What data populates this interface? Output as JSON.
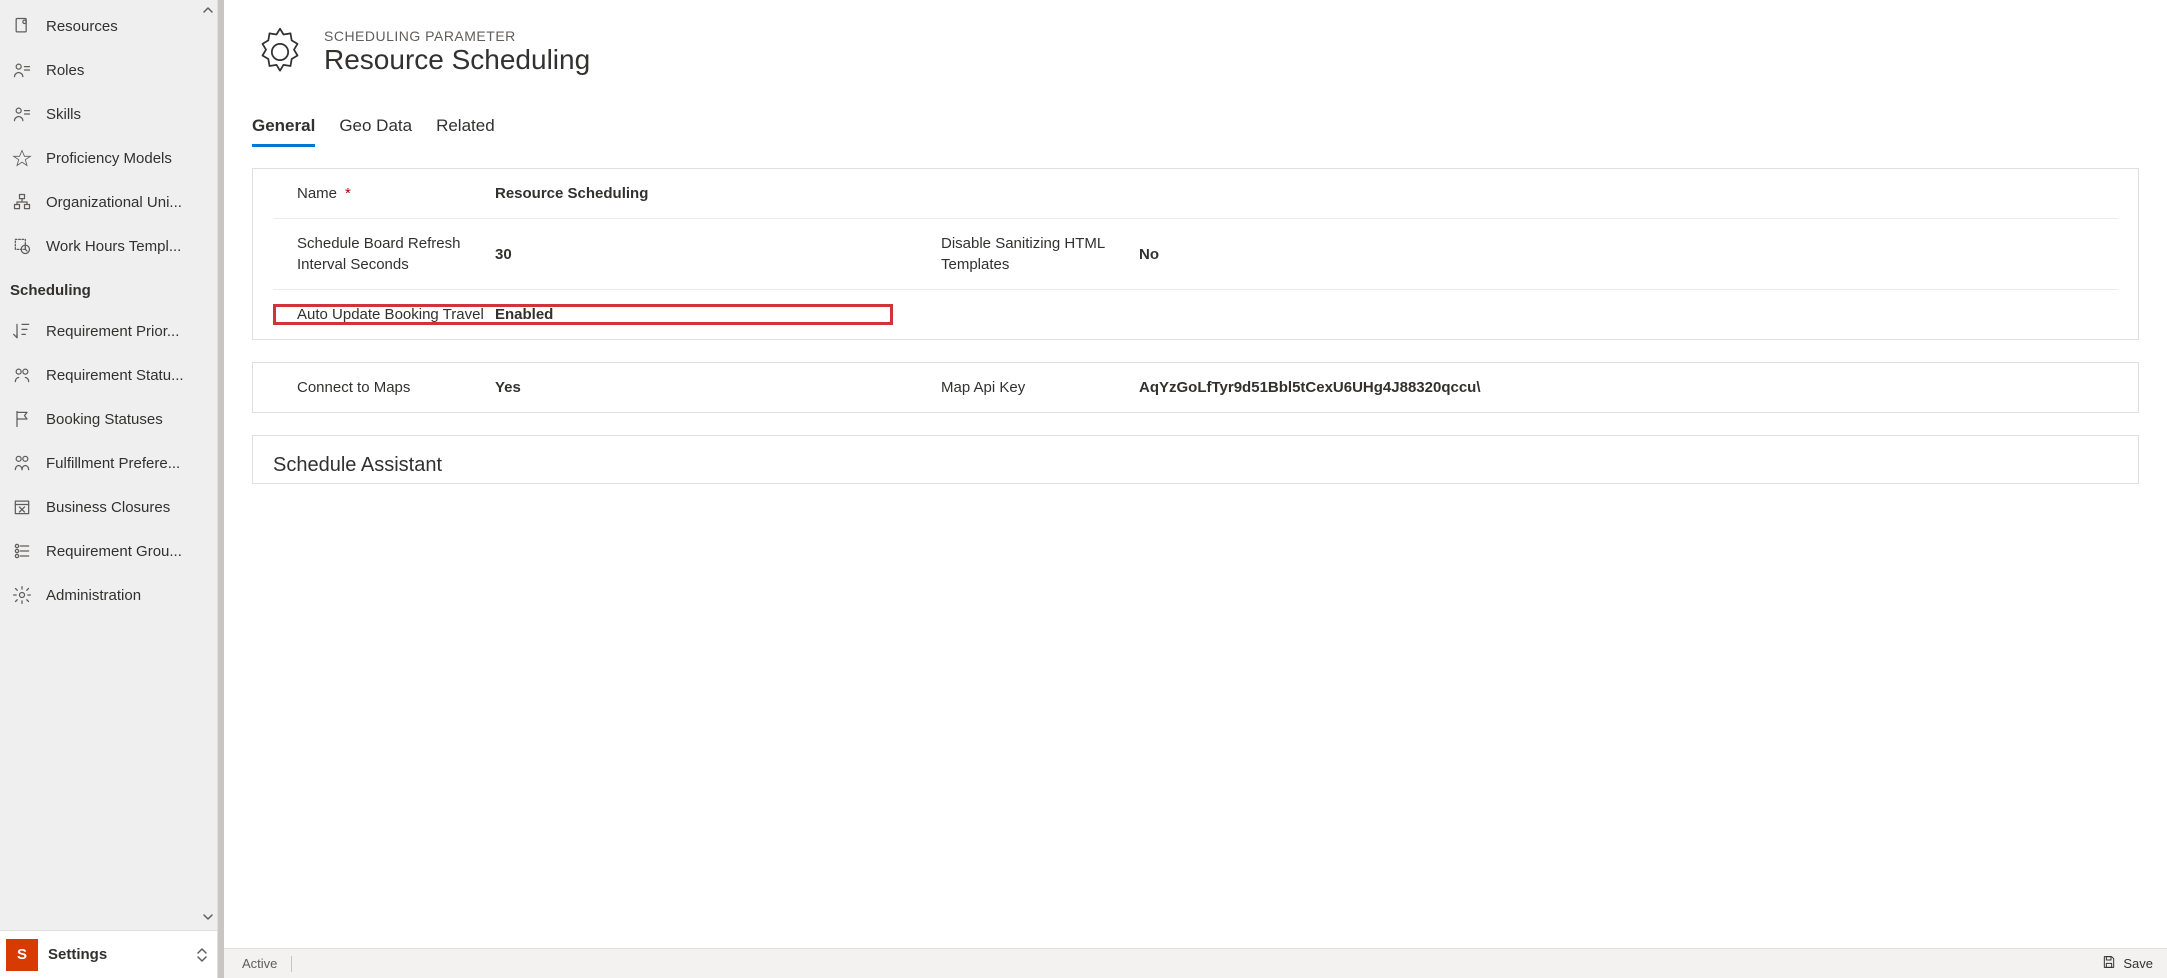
{
  "sidebar": {
    "items": [
      {
        "label": "Resources",
        "icon": "resources-icon"
      },
      {
        "label": "Roles",
        "icon": "roles-icon"
      },
      {
        "label": "Skills",
        "icon": "skills-icon"
      },
      {
        "label": "Proficiency Models",
        "icon": "star-icon"
      },
      {
        "label": "Organizational Uni...",
        "icon": "org-unit-icon"
      },
      {
        "label": "Work Hours Templ...",
        "icon": "work-hours-icon"
      }
    ],
    "section_title": "Scheduling",
    "scheduling_items": [
      {
        "label": "Requirement Prior...",
        "icon": "priority-icon"
      },
      {
        "label": "Requirement Statu...",
        "icon": "req-status-icon"
      },
      {
        "label": "Booking Statuses",
        "icon": "flag-icon"
      },
      {
        "label": "Fulfillment Prefere...",
        "icon": "fulfillment-icon"
      },
      {
        "label": "Business Closures",
        "icon": "closure-icon"
      },
      {
        "label": "Requirement Grou...",
        "icon": "req-group-icon"
      },
      {
        "label": "Administration",
        "icon": "gear-icon"
      }
    ]
  },
  "area_switcher": {
    "letter": "S",
    "label": "Settings"
  },
  "page": {
    "eyebrow": "SCHEDULING PARAMETER",
    "title": "Resource Scheduling"
  },
  "tabs": [
    {
      "label": "General",
      "active": true
    },
    {
      "label": "Geo Data",
      "active": false
    },
    {
      "label": "Related",
      "active": false
    }
  ],
  "form": {
    "name": {
      "label": "Name",
      "required": "*",
      "value": "Resource Scheduling"
    },
    "refresh_interval": {
      "label": "Schedule Board Refresh Interval Seconds",
      "value": "30"
    },
    "disable_sanitize": {
      "label": "Disable Sanitizing HTML Templates",
      "value": "No"
    },
    "auto_update_travel": {
      "label": "Auto Update Booking Travel",
      "value": "Enabled"
    },
    "connect_to_maps": {
      "label": "Connect to Maps",
      "value": "Yes"
    },
    "map_api_key": {
      "label": "Map Api Key",
      "value": "AqYzGoLfTyr9d51Bbl5tCexU6UHg4J88320qccu\\"
    },
    "schedule_assistant_title": "Schedule Assistant"
  },
  "statusbar": {
    "status": "Active",
    "save_label": "Save"
  }
}
